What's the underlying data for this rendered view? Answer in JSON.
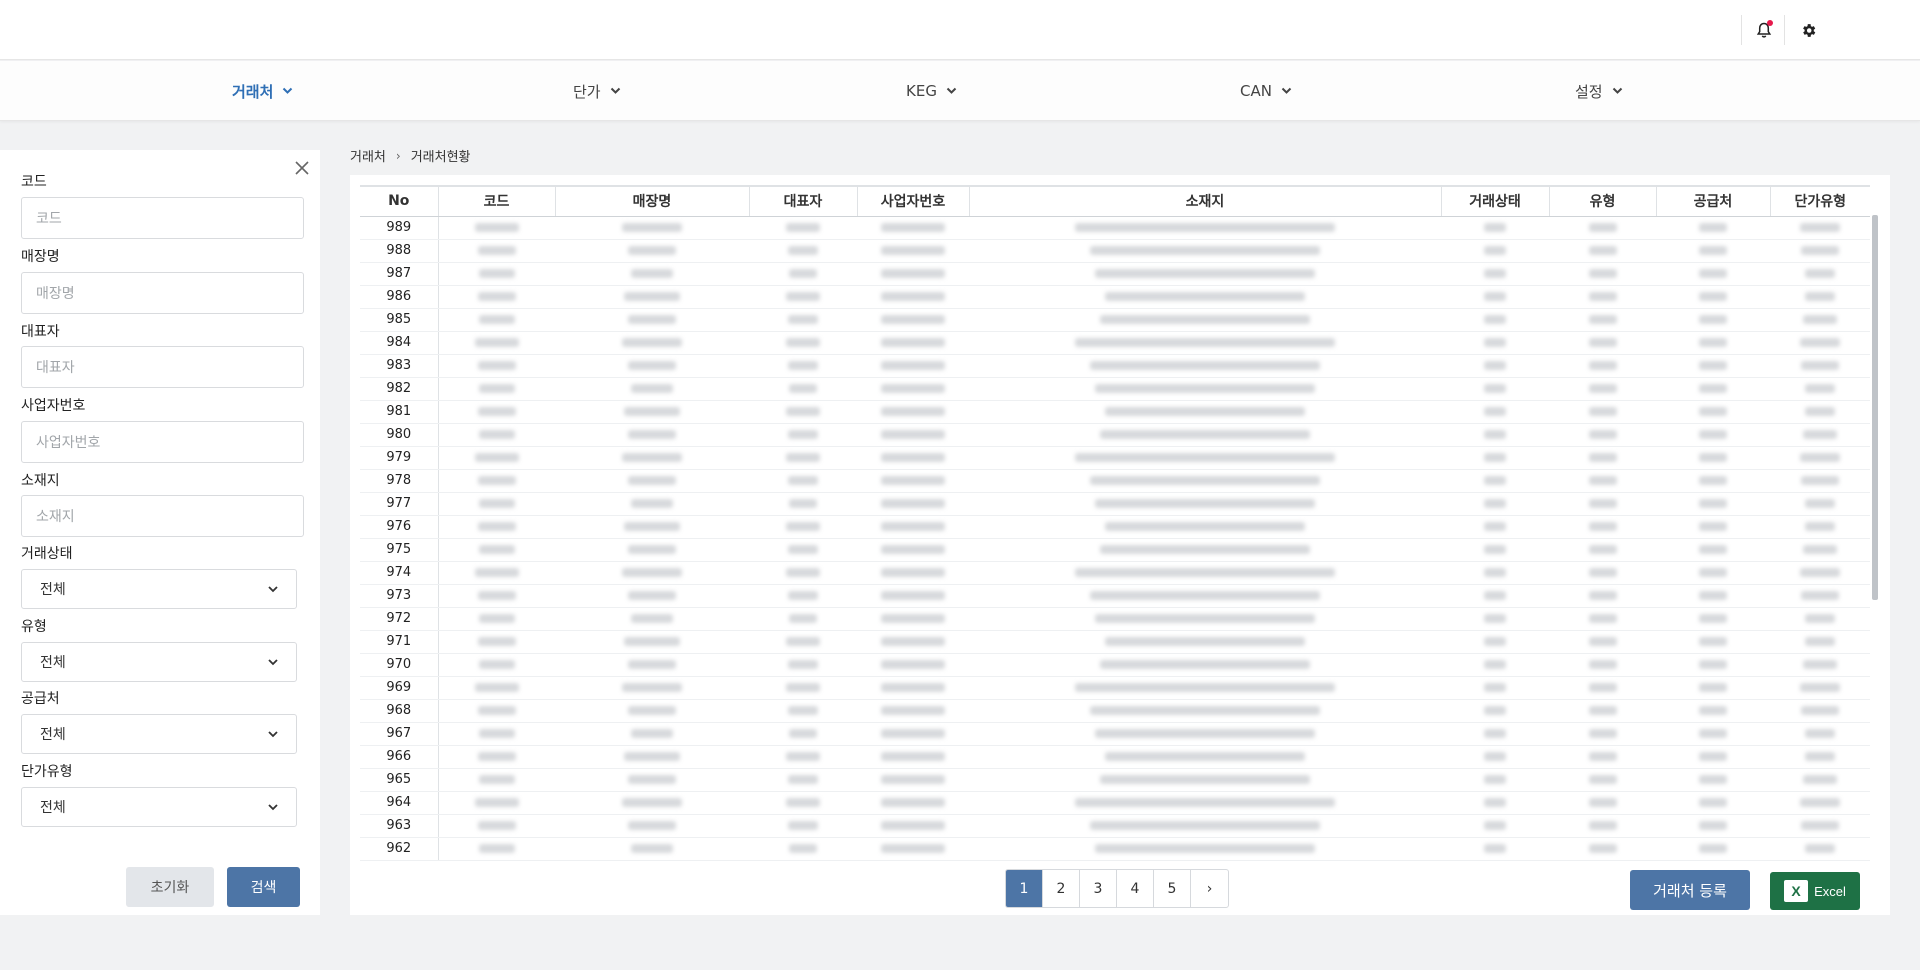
{
  "nav": {
    "items": [
      {
        "label": "거래처",
        "active": true
      },
      {
        "label": "단가"
      },
      {
        "label": "KEG"
      },
      {
        "label": "CAN"
      },
      {
        "label": "설정"
      }
    ]
  },
  "filter": {
    "code_label": "코드",
    "code_placeholder": "코드",
    "store_label": "매장명",
    "store_placeholder": "매장명",
    "ceo_label": "대표자",
    "ceo_placeholder": "대표자",
    "bizno_label": "사업자번호",
    "bizno_placeholder": "사업자번호",
    "address_label": "소재지",
    "address_placeholder": "소재지",
    "status_label": "거래상태",
    "status_value": "전체",
    "type_label": "유형",
    "type_value": "전체",
    "supplier_label": "공급처",
    "supplier_value": "전체",
    "price_type_label": "단가유형",
    "price_type_value": "전체",
    "reset_label": "초기화",
    "search_label": "검색"
  },
  "breadcrumb": {
    "root": "거래처",
    "separator": "›",
    "current": "거래처현황"
  },
  "table": {
    "columns": [
      "No",
      "코드",
      "매장명",
      "대표자",
      "사업자번호",
      "소재지",
      "거래상태",
      "유형",
      "공급처",
      "단가유형"
    ],
    "rows": [
      "989",
      "988",
      "987",
      "986",
      "985",
      "984",
      "983",
      "982",
      "981",
      "980",
      "979",
      "978",
      "977",
      "976",
      "975",
      "974",
      "973",
      "972",
      "971",
      "970",
      "969",
      "968",
      "967",
      "966",
      "965",
      "964",
      "963",
      "962"
    ]
  },
  "pagination": {
    "pages": [
      "1",
      "2",
      "3",
      "4",
      "5"
    ],
    "next": "›",
    "current": "1"
  },
  "actions": {
    "register_label": "거래처 등록",
    "excel_label": "Excel",
    "excel_icon_letter": "X"
  },
  "colors": {
    "accent": "#4d75a6",
    "nav_active": "#2f6fb5",
    "excel_green": "#1e7145",
    "notify_dot": "#e6194b"
  }
}
